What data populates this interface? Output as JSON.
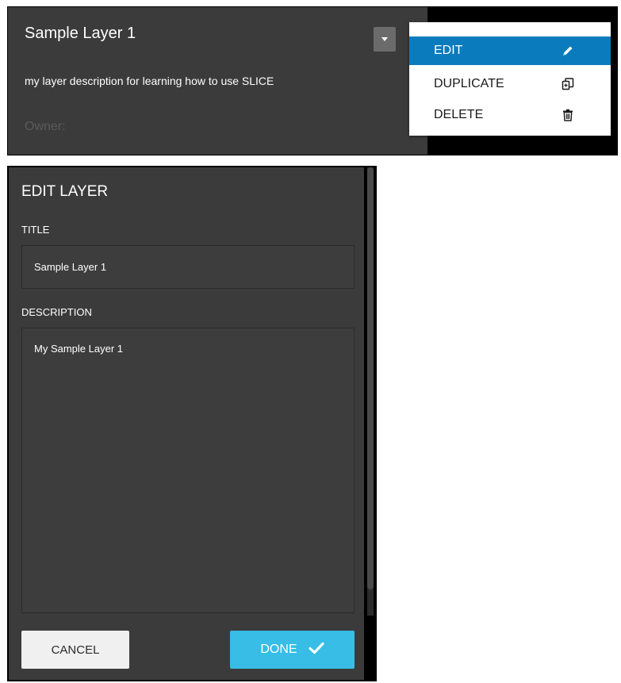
{
  "layer_card": {
    "title": "Sample Layer 1",
    "description": "my layer description for learning how to use SLICE",
    "owner_label": "Owner:"
  },
  "menu": {
    "items": [
      {
        "label": "EDIT",
        "icon": "pencil-icon"
      },
      {
        "label": "DUPLICATE",
        "icon": "duplicate-icon"
      },
      {
        "label": "DELETE",
        "icon": "trash-icon"
      }
    ],
    "active_color": "#0a7bbd"
  },
  "edit_panel": {
    "title": "EDIT LAYER",
    "title_label": "TITLE",
    "title_value": "Sample Layer 1",
    "description_label": "DESCRIPTION",
    "description_value": "My Sample Layer 1",
    "cancel_label": "CANCEL",
    "done_label": "DONE",
    "done_color": "#37bde6"
  }
}
